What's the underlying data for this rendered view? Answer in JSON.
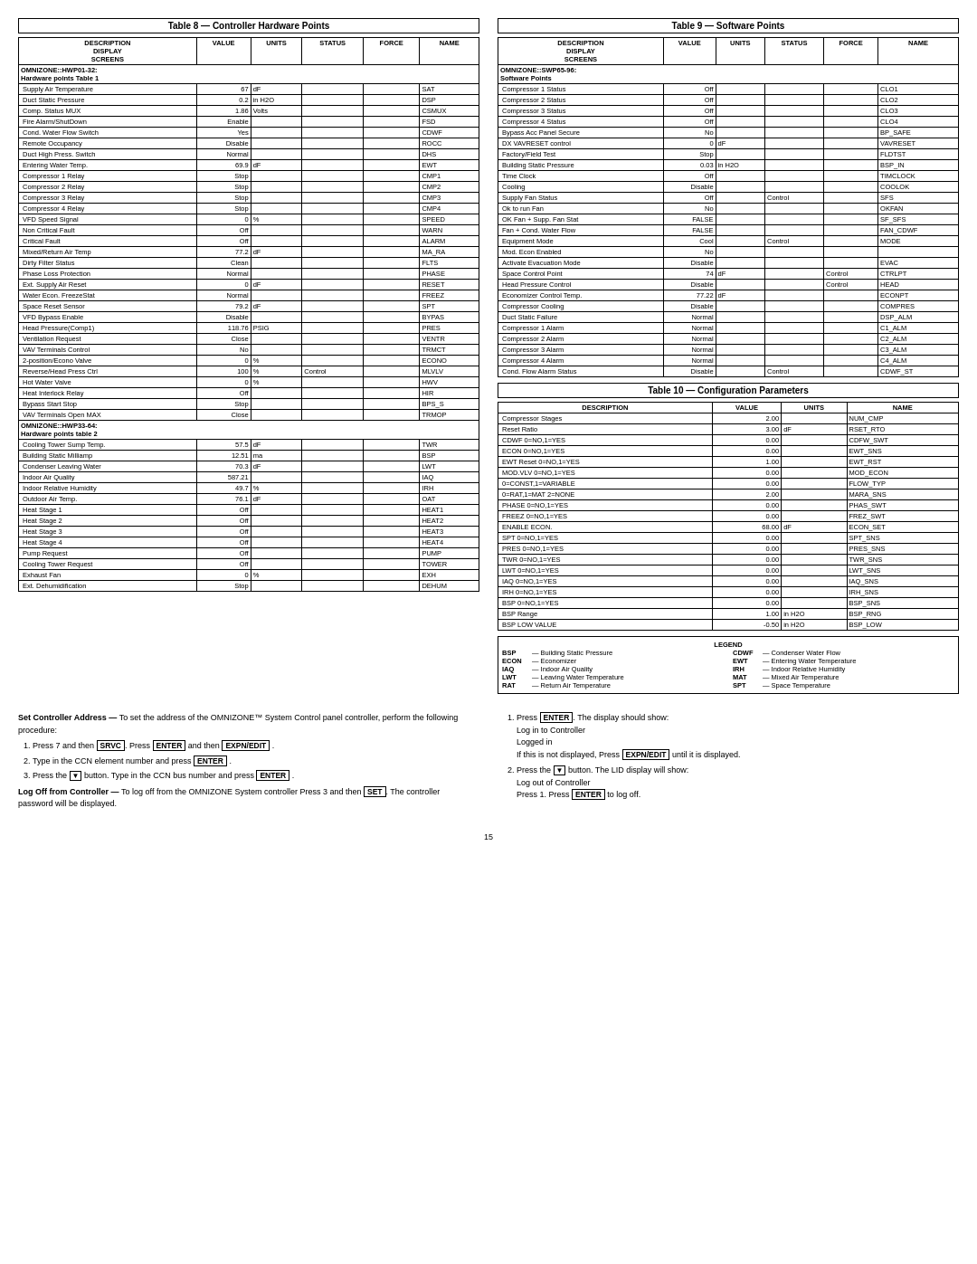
{
  "table8": {
    "title": "Table 8 — Controller Hardware Points",
    "headers": [
      "DESCRIPTION\nDISPLAY\nSCREENS",
      "VALUE",
      "UNITS",
      "STATUS",
      "FORCE",
      "NAME"
    ],
    "section1_header": "OMNIZONE::HWP01-32:\nHardware points Table 1",
    "section1_rows": [
      [
        "Supply Air Temperature",
        "67",
        "dF",
        "",
        "",
        "SAT"
      ],
      [
        "Duct Static Pressure",
        "0.2",
        "in H2O",
        "",
        "",
        "DSP"
      ],
      [
        "Comp. Status MUX",
        "1.86",
        "Volts",
        "",
        "",
        "CSMUX"
      ],
      [
        "Fire Alarm/ShutDown",
        "Enable",
        "",
        "",
        "",
        "FSD"
      ],
      [
        "Cond. Water Flow Switch",
        "Yes",
        "",
        "",
        "",
        "CDWF"
      ],
      [
        "Remote Occupancy",
        "Disable",
        "",
        "",
        "",
        "ROCC"
      ],
      [
        "Duct High Press. Switch",
        "Normal",
        "",
        "",
        "",
        "DHS"
      ],
      [
        "Entering Water Temp.",
        "69.9",
        "dF",
        "",
        "",
        "EWT"
      ],
      [
        "Compressor 1 Relay",
        "Stop",
        "",
        "",
        "",
        "CMP1"
      ],
      [
        "Compressor 2 Relay",
        "Stop",
        "",
        "",
        "",
        "CMP2"
      ],
      [
        "Compressor 3 Relay",
        "Stop",
        "",
        "",
        "",
        "CMP3"
      ],
      [
        "Compressor 4 Relay",
        "Stop",
        "",
        "",
        "",
        "CMP4"
      ],
      [
        "VFD Speed Signal",
        "0",
        "%",
        "",
        "",
        "SPEED"
      ],
      [
        "Non Critical Fault",
        "Off",
        "",
        "",
        "",
        "WARN"
      ],
      [
        "Critical Fault",
        "Off",
        "",
        "",
        "",
        "ALARM"
      ],
      [
        "Mixed/Return Air Temp",
        "77.2",
        "dF",
        "",
        "",
        "MA_RA"
      ],
      [
        "Dirty Filter Status",
        "Clean",
        "",
        "",
        "",
        "FLTS"
      ],
      [
        "Phase Loss Protection",
        "Normal",
        "",
        "",
        "",
        "PHASE"
      ],
      [
        "Ext. Supply Air Reset",
        "0",
        "dF",
        "",
        "",
        "RESET"
      ],
      [
        "Water Econ. FreezeStat",
        "Normal",
        "",
        "",
        "",
        "FREEZ"
      ],
      [
        "Space Reset Sensor",
        "79.2",
        "dF",
        "",
        "",
        "SPT"
      ],
      [
        "VFD Bypass Enable",
        "Disable",
        "",
        "",
        "",
        "BYPAS"
      ],
      [
        "Head Pressure(Comp1)",
        "118.76",
        "PSIG",
        "",
        "",
        "PRES"
      ],
      [
        "Ventilation Request",
        "Close",
        "",
        "",
        "",
        "VENTR"
      ],
      [
        "VAV Terminals Control",
        "No",
        "",
        "",
        "",
        "TRMCT"
      ],
      [
        "2-position/Econo Valve",
        "0",
        "%",
        "",
        "",
        "ECONO"
      ],
      [
        "Reverse/Head Press Ctrl",
        "100",
        "%",
        "Control",
        "",
        "MLVLV"
      ],
      [
        "Hot Water Valve",
        "0",
        "%",
        "",
        "",
        "HWV"
      ],
      [
        "Heat Interlock Relay",
        "Off",
        "",
        "",
        "",
        "HIR"
      ],
      [
        "Bypass Start  Stop",
        "Stop",
        "",
        "",
        "",
        "BPS_S"
      ],
      [
        "VAV Terminals Open MAX",
        "Close",
        "",
        "",
        "",
        "TRMOP"
      ]
    ],
    "section2_header": "OMNIZONE::HWP33-64:\nHardware points table 2",
    "section2_rows": [
      [
        "Cooling Tower Sump Temp.",
        "57.5",
        "dF",
        "",
        "",
        "TWR"
      ],
      [
        "Building Static Milliamp",
        "12.51",
        "ma",
        "",
        "",
        "BSP"
      ],
      [
        "Condenser Leaving Water",
        "70.3",
        "dF",
        "",
        "",
        "LWT"
      ],
      [
        "Indoor Air Quality",
        "587.21",
        "",
        "",
        "",
        "IAQ"
      ],
      [
        "Indoor Relative Humidity",
        "49.7",
        "%",
        "",
        "",
        "IRH"
      ],
      [
        "Outdoor Air Temp.",
        "76.1",
        "dF",
        "",
        "",
        "OAT"
      ],
      [
        "Heat Stage 1",
        "Off",
        "",
        "",
        "",
        "HEAT1"
      ],
      [
        "Heat Stage 2",
        "Off",
        "",
        "",
        "",
        "HEAT2"
      ],
      [
        "Heat Stage 3",
        "Off",
        "",
        "",
        "",
        "HEAT3"
      ],
      [
        "Heat Stage 4",
        "Off",
        "",
        "",
        "",
        "HEAT4"
      ],
      [
        "Pump Request",
        "Off",
        "",
        "",
        "",
        "PUMP"
      ],
      [
        "Cooling Tower Request",
        "Off",
        "",
        "",
        "",
        "TOWER"
      ],
      [
        "Exhaust Fan",
        "0",
        "%",
        "",
        "",
        "EXH"
      ],
      [
        "Ext. Dehumidification",
        "Stop",
        "",
        "",
        "",
        "DEHUM"
      ]
    ]
  },
  "table9": {
    "title": "Table 9 — Software Points",
    "headers": [
      "DESCRIPTION\nDISPLAY\nSCREENS",
      "VALUE",
      "UNITS",
      "STATUS",
      "FORCE",
      "NAME"
    ],
    "section1_header": "OMNIZONE::SWP65-96:\nSoftware Points",
    "section1_rows": [
      [
        "Compressor 1 Status",
        "Off",
        "",
        "",
        "",
        "CLO1"
      ],
      [
        "Compressor 2 Status",
        "Off",
        "",
        "",
        "",
        "CLO2"
      ],
      [
        "Compressor 3 Status",
        "Off",
        "",
        "",
        "",
        "CLO3"
      ],
      [
        "Compressor 4 Status",
        "Off",
        "",
        "",
        "",
        "CLO4"
      ],
      [
        "Bypass Acc Panel Secure",
        "No",
        "",
        "",
        "",
        "BP_SAFE"
      ],
      [
        "DX VAVRESET control",
        "0",
        "dF",
        "",
        "",
        "VAVRESET"
      ],
      [
        "Factory/Field Test",
        "Stop",
        "",
        "",
        "",
        "FLDTST"
      ],
      [
        "Building Static Pressure",
        "0.03",
        "in H2O",
        "",
        "",
        "BSP_IN"
      ],
      [
        "Time Clock",
        "Off",
        "",
        "",
        "",
        "TIMCLOCK"
      ],
      [
        "Cooling",
        "Disable",
        "",
        "",
        "",
        "COOLOK"
      ],
      [
        "Supply Fan Status",
        "Off",
        "",
        "Control",
        "",
        "SFS"
      ],
      [
        "Ok to run Fan",
        "No",
        "",
        "",
        "",
        "OKFAN"
      ],
      [
        "OK Fan + Supp. Fan Stat",
        "FALSE",
        "",
        "",
        "",
        "SF_SFS"
      ],
      [
        "Fan + Cond. Water Flow",
        "FALSE",
        "",
        "",
        "",
        "FAN_CDWF"
      ],
      [
        "Equipment Mode",
        "Cool",
        "",
        "Control",
        "",
        "MODE"
      ],
      [
        "Activate Evacuation Mode",
        "Disable",
        "",
        "",
        "",
        "EVAC"
      ],
      [
        "Space Control Point",
        "74",
        "dF",
        "",
        "Control",
        "CTRLPT"
      ],
      [
        "Head Pressure Control",
        "Disable",
        "",
        "",
        "Control",
        "HEAD"
      ],
      [
        "Economizer Control Temp.",
        "77.22",
        "dF",
        "",
        "",
        "ECONPT"
      ],
      [
        "Compressor Cooling",
        "Disable",
        "",
        "",
        "",
        "COMPRES"
      ],
      [
        "Duct Static Failure",
        "Normal",
        "",
        "",
        "",
        "DSP_ALM"
      ],
      [
        "Compressor 1 Alarm",
        "Normal",
        "",
        "",
        "",
        "C1_ALM"
      ],
      [
        "Compressor 2 Alarm",
        "Normal",
        "",
        "",
        "",
        "C2_ALM"
      ],
      [
        "Compressor 3 Alarm",
        "Normal",
        "",
        "",
        "",
        "C3_ALM"
      ],
      [
        "Compressor 4 Alarm",
        "Normal",
        "",
        "",
        "",
        "C4_ALM"
      ],
      [
        "Cond. Flow Alarm Status",
        "Disable",
        "",
        "Control",
        "",
        "CDWF_ST"
      ]
    ],
    "econ_enabled": [
      "Mod. Econ Enabled",
      "No",
      "",
      "",
      "",
      ""
    ]
  },
  "table10": {
    "title": "Table 10 — Configuration Parameters",
    "headers": [
      "DESCRIPTION",
      "VALUE",
      "UNITS",
      "NAME"
    ],
    "rows": [
      [
        "Compressor Stages",
        "2.00",
        "",
        "NUM_CMP"
      ],
      [
        "Reset Ratio",
        "3.00",
        "dF",
        "RSET_RTO"
      ],
      [
        "CDWF 0=NO,1=YES",
        "0.00",
        "",
        "CDFW_SWT"
      ],
      [
        "ECON 0=NO,1=YES",
        "0.00",
        "",
        "EWT_SNS"
      ],
      [
        "EWT Reset 0=NO,1=YES",
        "1.00",
        "",
        "EWT_RST"
      ],
      [
        "MOD.VLV 0=NO,1=YES",
        "0.00",
        "",
        "MOD_ECON"
      ],
      [
        "0=CONST,1=VARIABLE",
        "0.00",
        "",
        "FLOW_TYP"
      ],
      [
        "0=RAT,1=MAT 2=NONE",
        "2.00",
        "",
        "MARA_SNS"
      ],
      [
        "PHASE 0=NO,1=YES",
        "0.00",
        "",
        "PHAS_SWT"
      ],
      [
        "FREEZ 0=NO,1=YES",
        "0.00",
        "",
        "FREZ_SWT"
      ],
      [
        "ENABLE ECON.",
        "68.00",
        "dF",
        "ECON_SET"
      ],
      [
        "SPT 0=NO,1=YES",
        "0.00",
        "",
        "SPT_SNS"
      ],
      [
        "PRES 0=NO,1=YES",
        "0.00",
        "",
        "PRES_SNS"
      ],
      [
        "TWR 0=NO,1=YES",
        "0.00",
        "",
        "TWR_SNS"
      ],
      [
        "LWT 0=NO,1=YES",
        "0.00",
        "",
        "LWT_SNS"
      ],
      [
        "IAQ 0=NO,1=YES",
        "0.00",
        "",
        "IAQ_SNS"
      ],
      [
        "IRH 0=NO,1=YES",
        "0.00",
        "",
        "IRH_SNS"
      ],
      [
        "BSP 0=NO,1=YES",
        "0.00",
        "",
        "BSP_SNS"
      ],
      [
        "BSP Range",
        "1.00",
        "in H2O",
        "BSP_RNG"
      ],
      [
        "BSP LOW VALUE",
        "-0.50",
        "in H2O",
        "BSP_LOW"
      ]
    ]
  },
  "legend": {
    "title": "LEGEND",
    "items": [
      {
        "abbr": "BSP",
        "desc": "— Building Static Pressure"
      },
      {
        "abbr": "CDWF",
        "desc": "— Condenser Water Flow"
      },
      {
        "abbr": "ECON",
        "desc": "— Economizer"
      },
      {
        "abbr": "EWT",
        "desc": "— Entering Water Temperature"
      },
      {
        "abbr": "IAQ",
        "desc": "— Indoor Air Quality"
      },
      {
        "abbr": "IRH",
        "desc": "— Indoor Relative Humidity"
      },
      {
        "abbr": "LWT",
        "desc": "— Leaving Water Temperature"
      },
      {
        "abbr": "MAT",
        "desc": "— Mixed Air Temperature"
      },
      {
        "abbr": "RAT",
        "desc": "— Return Air Temperature"
      },
      {
        "abbr": "SPT",
        "desc": "— Space Temperature"
      }
    ]
  },
  "set_controller": {
    "heading": "Set Controller Address",
    "heading_dash": " — ",
    "intro": "To set the address of the OMNIZONE™ System Control panel controller, perform the following procedure:",
    "steps": [
      {
        "text": "Press 7 and then ",
        "key1": "SRVC",
        "middle": ". Press ",
        "key2": "ENTER",
        "end": " and then ",
        "key3": "EXPN/EDIT",
        "end2": " ."
      },
      {
        "text": "Type in the CCN element number and press ",
        "key1": "ENTER",
        "end": " ."
      },
      {
        "text_pre": "Press the ",
        "icon": "▼",
        "text_post": " button. Type in the CCN bus number and press ",
        "key1": "ENTER",
        "end": " ."
      }
    ]
  },
  "log_off": {
    "heading": "Log Off from Controller",
    "heading_dash": " — ",
    "text": "To log off from the OMNIZONE System controller Press 3 and then ",
    "key1": "SET",
    "text2": ". The controller password will be displayed."
  },
  "right_steps": {
    "step1": "Press ",
    "step1_key": "ENTER",
    "step1_end": ". The display should show:",
    "step1_line1": "Log in to Controller",
    "step1_line2": "Logged in",
    "step1_note": "If this is not displayed, Press ",
    "step1_note_key": "EXPN/EDIT",
    "step1_note_end": " until it is displayed.",
    "step2_pre": "Press the ",
    "step2_icon": "▼",
    "step2_post": " button. The LID display will show:",
    "step2_line1": "Log out of Controller",
    "step2_line2": "Press 1. Press ",
    "step2_key": "ENTER",
    "step2_end": " to log off."
  },
  "page_number": "15"
}
